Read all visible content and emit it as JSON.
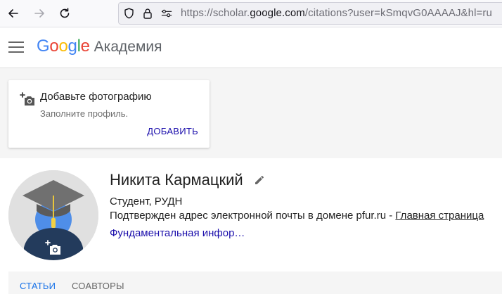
{
  "browser": {
    "url_prefix": "https://scholar.",
    "url_host": "google.com",
    "url_path": "/citations?user=kSmqvG0AAAAJ&hl=ru"
  },
  "header": {
    "brand_letters": [
      "G",
      "o",
      "o",
      "g",
      "l",
      "e"
    ],
    "brand_colors": [
      "#4285F4",
      "#EA4335",
      "#FBBC05",
      "#4285F4",
      "#34A853",
      "#EA4335"
    ],
    "product": "Академия"
  },
  "photo_card": {
    "title": "Добавьте фотографию",
    "subtitle": "Заполните профиль.",
    "action": "ДОБАВИТЬ"
  },
  "profile": {
    "name": "Никита Кармацкий",
    "affiliation": "Студент, РУДН",
    "email_verified": "Подтвержден адрес электронной почты в домене pfur.ru - ",
    "homepage_label": "Главная страница",
    "interest": "Фундаментальная инфор…"
  },
  "tabs": {
    "articles": "СТАТЬИ",
    "coauthors": "СОАВТОРЫ"
  },
  "colors": {
    "link": "#1a0dab",
    "active_tab": "#1a73e8"
  }
}
